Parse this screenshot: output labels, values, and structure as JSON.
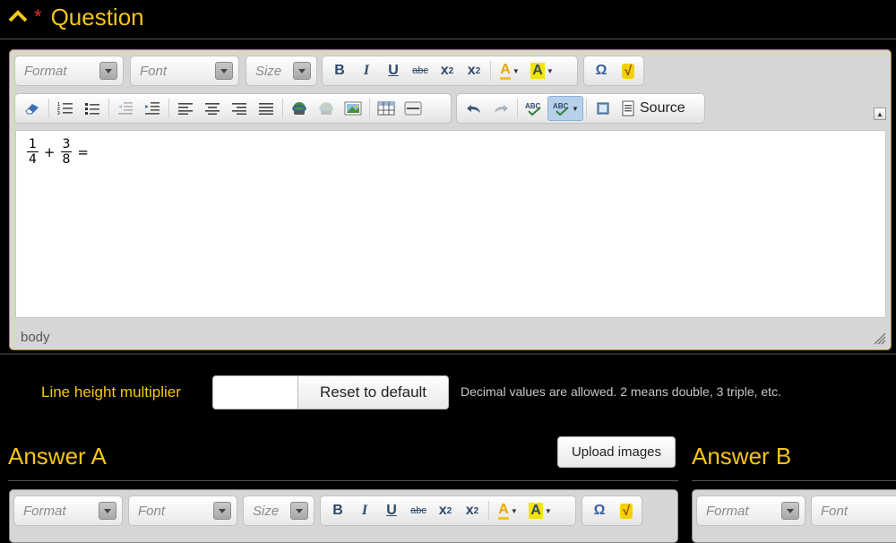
{
  "question": {
    "collapse_icon": "chevron-up-icon",
    "required_mark": "*",
    "title": "Question"
  },
  "editor": {
    "combos": {
      "format": "Format",
      "font": "Font",
      "size": "Size"
    },
    "toolbar_row1_icons": [
      "bold-icon",
      "italic-icon",
      "underline-icon",
      "strikethrough-icon",
      "subscript-icon",
      "superscript-icon",
      "text-color-icon",
      "background-color-icon",
      "special-character-icon",
      "math-formula-icon"
    ],
    "toolbar_row1_glyphs": {
      "bold": "B",
      "italic": "I",
      "underline": "U",
      "strike": "abc",
      "sub": "x",
      "sub_index": "2",
      "sup": "x",
      "sup_index": "2",
      "textcolor": "A",
      "bgcolor": "A",
      "omega": "Ω",
      "sqrt": "√"
    },
    "toolbar_row2_icons": [
      "remove-format-icon",
      "numbered-list-icon",
      "bulleted-list-icon",
      "decrease-indent-icon",
      "increase-indent-icon",
      "align-left-icon",
      "align-center-icon",
      "align-right-icon",
      "justify-icon",
      "link-icon",
      "unlink-icon",
      "image-icon",
      "table-icon",
      "horizontal-line-icon",
      "undo-icon",
      "redo-icon",
      "spellcheck-icon",
      "spellcheck-as-you-type-icon",
      "maximize-icon",
      "source-icon"
    ],
    "source_label": "Source",
    "content": {
      "frac1_num": "1",
      "frac1_den": "4",
      "plus": "+",
      "frac2_num": "3",
      "frac2_den": "8",
      "equals": "="
    },
    "status_path": "body",
    "colors": {
      "frame_border": "#b08a28",
      "toolbar_bg": "#d6d6d6",
      "accent": "#f5c518"
    }
  },
  "line_height": {
    "label": "Line height multiplier",
    "value": "",
    "reset_button": "Reset to default",
    "hint": "Decimal values are allowed. 2 means double, 3 triple, etc."
  },
  "answer_a": {
    "title": "Answer A",
    "upload_button": "Upload images",
    "combos": {
      "format": "Format",
      "font": "Font",
      "size": "Size"
    }
  },
  "answer_b": {
    "title": "Answer B",
    "combos": {
      "format": "Format",
      "font": "Font"
    }
  }
}
